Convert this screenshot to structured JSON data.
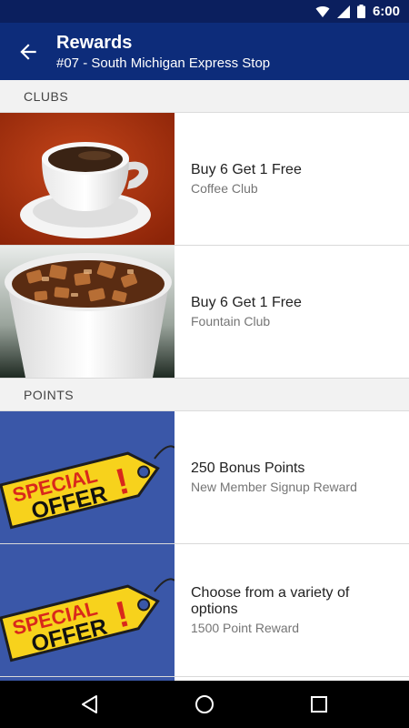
{
  "status_bar": {
    "time": "6:00",
    "icons": [
      "wifi-icon",
      "signal-icon",
      "battery-icon"
    ]
  },
  "app_bar": {
    "title": "Rewards",
    "subtitle": "#07 - South Michigan Express Stop",
    "back_icon": "arrow-back-icon"
  },
  "sections": {
    "clubs": {
      "label": "CLUBS"
    },
    "points": {
      "label": "POINTS"
    }
  },
  "clubs": [
    {
      "primary": "Buy 6 Get 1 Free",
      "secondary": "Coffee Club",
      "image": "coffee-cup"
    },
    {
      "primary": "Buy 6 Get 1 Free",
      "secondary": "Fountain Club",
      "image": "fountain-drink"
    }
  ],
  "points": [
    {
      "primary": "250 Bonus Points",
      "secondary": "New Member Signup Reward",
      "image": "special-offer-tag"
    },
    {
      "primary": "Choose from a variety of options",
      "secondary": "1500 Point Reward",
      "image": "special-offer-tag"
    }
  ],
  "offer_tag": {
    "line1": "SPECIAL",
    "line2": "OFFER",
    "mark": "!"
  },
  "colors": {
    "status_bar": "#0b1f5e",
    "app_bar": "#0d2c7a",
    "offer_bg": "#3a57a8",
    "tag_yellow": "#f7d21c",
    "offer_red": "#d9281b",
    "coffee_bg": "#a8310f"
  },
  "nav": {
    "back": "back-triangle-icon",
    "home": "home-circle-icon",
    "recents": "recents-square-icon"
  }
}
